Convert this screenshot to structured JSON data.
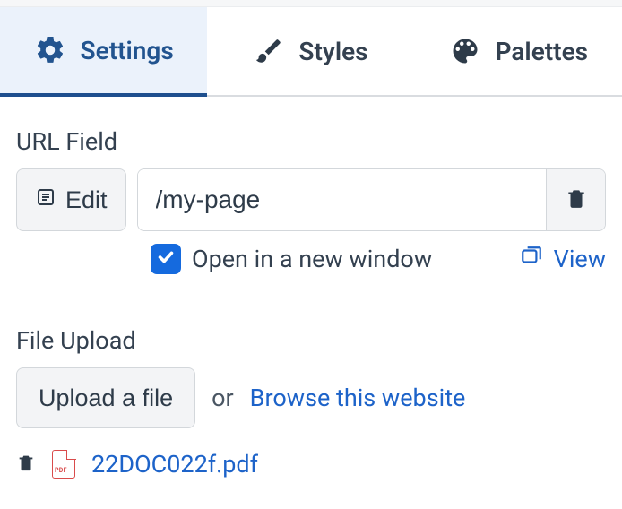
{
  "tabs": {
    "settings": "Settings",
    "styles": "Styles",
    "palettes": "Palettes"
  },
  "url_section": {
    "label": "URL Field",
    "edit_button": "Edit",
    "input_value": "/my-page",
    "checkbox_label": "Open in a new window",
    "view_label": "View"
  },
  "file_section": {
    "label": "File Upload",
    "upload_button": "Upload a file",
    "or_text": "or",
    "browse_link": "Browse this website",
    "uploaded_file": "22DOC022f.pdf",
    "pdf_badge": "PDF"
  },
  "colors": {
    "accent": "#156ade",
    "link": "#1d63c9"
  }
}
